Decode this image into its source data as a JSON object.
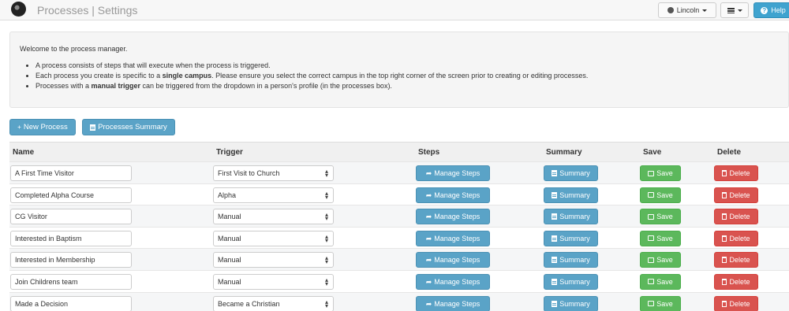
{
  "header": {
    "title": "Processes | Settings",
    "campus_label": "Lincoln",
    "help_label": "Help"
  },
  "intro": {
    "welcome": "Welcome to the process manager.",
    "bullet1": "A process consists of steps that will execute when the process is triggered.",
    "bullet2_pre": "Each process you create is specific to a ",
    "bullet2_bold": "single campus",
    "bullet2_post": ". Please ensure you select the correct campus in the top right corner of the screen prior to creating or editing processes.",
    "bullet3_pre": "Processes with a ",
    "bullet3_bold": "manual trigger",
    "bullet3_post": " can be triggered from the dropdown in a person's profile (in the processes box)."
  },
  "actions": {
    "new_process": "New Process",
    "processes_summary": "Processes Summary"
  },
  "table": {
    "headers": {
      "name": "Name",
      "trigger": "Trigger",
      "steps": "Steps",
      "summary": "Summary",
      "save": "Save",
      "delete": "Delete"
    },
    "button_labels": {
      "steps": "Manage Steps",
      "summary": "Summary",
      "save": "Save",
      "delete": "Delete"
    },
    "rows": [
      {
        "name": "A First Time Visitor",
        "trigger": "First Visit to Church"
      },
      {
        "name": "Completed Alpha Course",
        "trigger": "Alpha"
      },
      {
        "name": "CG Visitor",
        "trigger": "Manual"
      },
      {
        "name": "Interested in Baptism",
        "trigger": "Manual"
      },
      {
        "name": "Interested in Membership",
        "trigger": "Manual"
      },
      {
        "name": "Join Childrens team",
        "trigger": "Manual"
      },
      {
        "name": "Made a Decision",
        "trigger": "Became a Christian"
      }
    ]
  },
  "colors": {
    "info_blue": "#5aa3c7",
    "success_green": "#5cb85c",
    "danger_red": "#d9534f",
    "help_blue": "#3fa3cf"
  }
}
